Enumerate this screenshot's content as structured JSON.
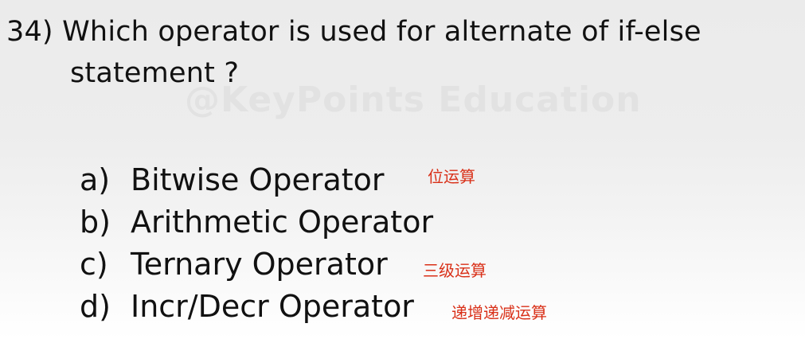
{
  "question": {
    "number": "34)",
    "line1": "Which operator is used for alternate of if-else",
    "line2": "statement ?"
  },
  "watermark": "@KeyPoints Education",
  "options": [
    {
      "letter": "a)",
      "text": "Bitwise Operator",
      "note": "位运算"
    },
    {
      "letter": "b)",
      "text": "Arithmetic Operator",
      "note": ""
    },
    {
      "letter": "c)",
      "text": "Ternary Operator",
      "note": "三级运算"
    },
    {
      "letter": "d)",
      "text": "Incr/Decr Operator",
      "note": "递增递减运算"
    }
  ],
  "colors": {
    "note": "#d93018",
    "text": "#111111",
    "watermark": "#e2e2e2"
  }
}
